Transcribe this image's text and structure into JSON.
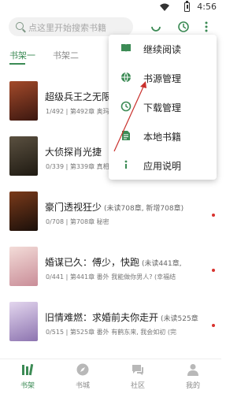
{
  "status_bar": {
    "time": "4:56"
  },
  "search": {
    "placeholder": "点这里开始搜索书籍"
  },
  "tabs": [
    {
      "label": "书架一"
    },
    {
      "label": "书架二"
    }
  ],
  "books": [
    {
      "title": "超级兵王之无限",
      "extra": "",
      "meta": "1/492 | 第492章 奥玛",
      "cover_color": "#6b2e1f",
      "unread": false
    },
    {
      "title": "大侦探肖光捷",
      "extra": "",
      "meta": "0/339 | 第339章 真相",
      "cover_color": "#3a3020",
      "unread": false
    },
    {
      "title": "豪门透视狂少",
      "extra": "(未读708章, 新增708章)",
      "meta": "0/708 | 第708章 秘密",
      "cover_color": "#2a1a14",
      "unread": true
    },
    {
      "title": "婚谋已久：傅少，快跑",
      "extra": "(未读441章,",
      "meta": "0/441 | 第441章 番外 我能做你男人? (幸福结",
      "cover_color": "#e8c9c6",
      "unread": true
    },
    {
      "title": "旧情难燃：求婚前夫你走开",
      "extra": "(未读525章",
      "meta": "0/515 | 第525章 番外 有鹤东来, 我会如初 (完",
      "cover_color": "#c9b5d8",
      "unread": true
    }
  ],
  "menu": {
    "items": [
      {
        "label": "继续阅读",
        "icon": "book-icon"
      },
      {
        "label": "书源管理",
        "icon": "globe-icon"
      },
      {
        "label": "下载管理",
        "icon": "clock-icon"
      },
      {
        "label": "本地书籍",
        "icon": "file-icon"
      },
      {
        "label": "应用说明",
        "icon": "info-icon"
      }
    ]
  },
  "bottom_nav": [
    {
      "label": "书架",
      "icon": "bookshelf-icon",
      "active": true
    },
    {
      "label": "书城",
      "icon": "compass-icon",
      "active": false
    },
    {
      "label": "社区",
      "icon": "chat-icon",
      "active": false
    },
    {
      "label": "我的",
      "icon": "user-icon",
      "active": false
    }
  ],
  "colors": {
    "accent": "#3c8b55",
    "badge": "#d8322e"
  }
}
